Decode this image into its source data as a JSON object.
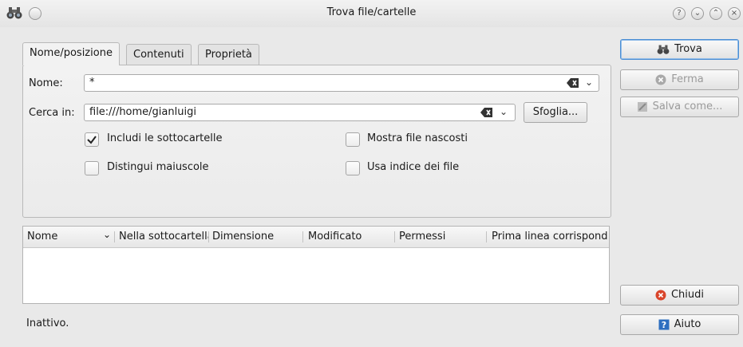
{
  "window": {
    "title": "Trova file/cartelle",
    "title_icon": "binoculars-icon"
  },
  "titlebar_buttons": [
    "help-icon",
    "minimize-icon",
    "maximize-icon",
    "close-icon"
  ],
  "tabs": [
    {
      "label": "Nome/posizione",
      "active": true
    },
    {
      "label": "Contenuti",
      "active": false
    },
    {
      "label": "Proprietà",
      "active": false
    }
  ],
  "name_field": {
    "label": "Nome:",
    "value": "*"
  },
  "search_in": {
    "label": "Cerca in:",
    "value": "file:///home/gianluigi",
    "browse_label": "Sfoglia..."
  },
  "options": {
    "subfolders": {
      "label": "Includi le sottocartelle",
      "checked": true
    },
    "case": {
      "label": "Distingui maiuscole",
      "checked": false
    },
    "hidden": {
      "label": "Mostra file nascosti",
      "checked": false
    },
    "index": {
      "label": "Usa indice dei file",
      "checked": false
    }
  },
  "results": {
    "columns": [
      "Nome",
      "Nella sottocartella",
      "Dimensione",
      "Modificato",
      "Permessi",
      "Prima linea corrispondente"
    ],
    "rows": []
  },
  "buttons": {
    "find": {
      "label": "Trova",
      "enabled": true
    },
    "stop": {
      "label": "Ferma",
      "enabled": false
    },
    "save_as": {
      "label": "Salva come...",
      "enabled": false
    },
    "close": {
      "label": "Chiudi",
      "enabled": true
    },
    "help": {
      "label": "Aiuto",
      "enabled": true
    }
  },
  "status": "Inattivo.",
  "colors": {
    "accent": "#4b8ed4",
    "close_red": "#d9452b",
    "help_blue": "#2e6fc0"
  }
}
